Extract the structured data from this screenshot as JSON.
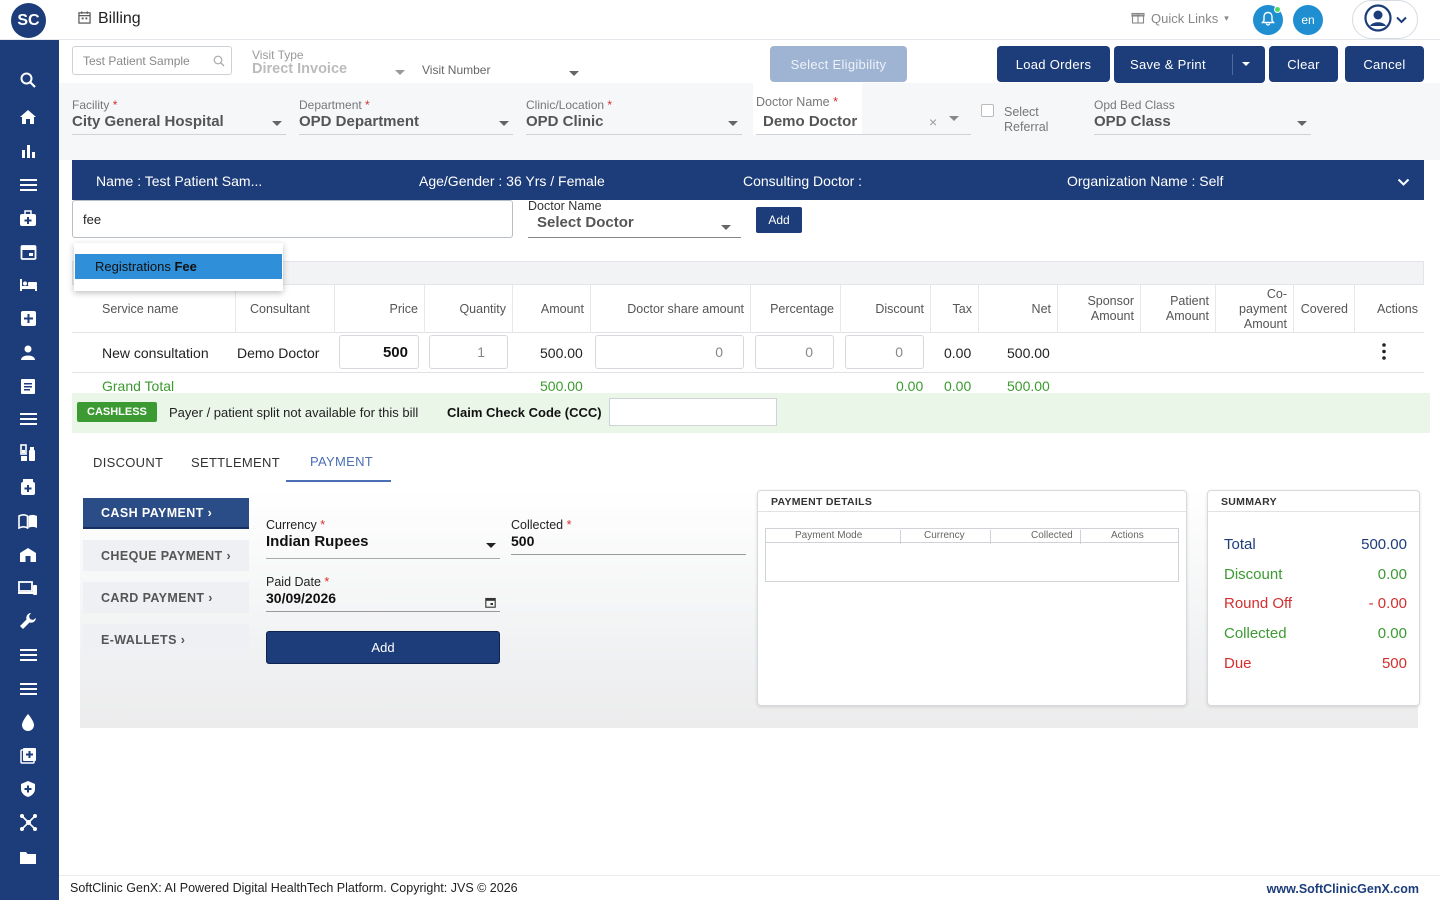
{
  "app": {
    "logo_text": "SC",
    "page_title": "Billing",
    "quick_links": "Quick Links",
    "language": "en"
  },
  "colors": {
    "brand": "#1d3d7a",
    "accent": "#1f8fd1",
    "success": "#3c9a33",
    "danger": "#d32f2f"
  },
  "sidebar": {
    "icons": [
      "search-icon",
      "home-icon",
      "bar-chart-icon",
      "menu-icon",
      "medical-bag-icon",
      "calendar-icon",
      "bed-icon",
      "plus-box-icon",
      "person-icon",
      "document-icon",
      "list-icon",
      "lab-icon",
      "pharmacy-icon",
      "book-icon",
      "hospital-icon",
      "devices-icon",
      "wrench-icon",
      "menu-icon",
      "list-icon",
      "blood-drop-icon",
      "add-box-icon",
      "shield-icon",
      "network-icon",
      "folder-icon"
    ]
  },
  "header_form": {
    "patient_search_placeholder": "Test Patient Sample",
    "visit_type_label": "Visit Type",
    "visit_type_value": "Direct Invoice",
    "visit_number_label": "Visit Number",
    "select_eligibility": "Select Eligibility",
    "load_orders": "Load Orders",
    "save_print": "Save & Print",
    "clear": "Clear",
    "cancel": "Cancel",
    "facility_label": "Facility",
    "facility_value": "City General Hospital",
    "department_label": "Department",
    "department_value": "OPD Department",
    "clinic_label": "Clinic/Location",
    "clinic_value": "OPD Clinic",
    "doctor_label": "Doctor Name",
    "doctor_value": "Demo Doctor",
    "select_referral_line1": "Select",
    "select_referral_line2": "Referral",
    "bed_class_label": "Opd Bed Class",
    "bed_class_value": "OPD Class",
    "required_mark": "*"
  },
  "banner": {
    "name": "Name :  Test Patient Sam...",
    "age_gender": "Age/Gender :  36 Yrs / Female",
    "consulting_doctor": "Consulting Doctor :",
    "organization": "Organization Name :  Self"
  },
  "service_entry": {
    "search_value": "fee",
    "suggestion_prefix": "Registrations ",
    "suggestion_match": "Fee",
    "doctor_label": "Doctor Name",
    "doctor_placeholder": "Select Doctor",
    "add_label": "Add"
  },
  "table": {
    "headers": {
      "service": "Service name",
      "consultant": "Consultant",
      "price": "Price",
      "quantity": "Quantity",
      "amount": "Amount",
      "doctor_share": "Doctor share amount",
      "percentage": "Percentage",
      "discount": "Discount",
      "tax": "Tax",
      "net": "Net",
      "sponsor_l1": "Sponsor",
      "sponsor_l2": "Amount",
      "patient_l1": "Patient",
      "patient_l2": "Amount",
      "copay_l1": "Co-",
      "copay_l2": "payment",
      "copay_l3": "Amount",
      "covered": "Covered",
      "actions": "Actions"
    },
    "rows": [
      {
        "service": "New consultation",
        "consultant": "Demo Doctor",
        "price": "500",
        "quantity": "1",
        "amount": "500.00",
        "doctor_share": "0",
        "percentage": "0",
        "discount": "0",
        "tax": "0.00",
        "net": "500.00"
      }
    ],
    "grand_total": {
      "label": "Grand Total",
      "amount": "500.00",
      "discount": "0.00",
      "tax": "0.00",
      "net": "500.00"
    }
  },
  "cashless": {
    "badge": "CASHLESS",
    "note": "Payer / patient split not available for this bill",
    "ccc_label": "Claim Check Code (CCC)"
  },
  "tabs": [
    "DISCOUNT",
    "SETTLEMENT",
    "PAYMENT"
  ],
  "payment": {
    "modes": [
      "CASH PAYMENT ›",
      "CHEQUE PAYMENT ›",
      "CARD PAYMENT ›",
      "E-WALLETS ›"
    ],
    "currency_label": "Currency",
    "currency_value": "Indian Rupees",
    "collected_label": "Collected",
    "collected_value": "500",
    "paid_date_label": "Paid Date",
    "paid_date_value": "30/09/2026",
    "add_label": "Add",
    "details_title": "PAYMENT DETAILS",
    "details_headers": [
      "Payment Mode",
      "Currency",
      "Collected",
      "Actions"
    ]
  },
  "summary": {
    "title": "SUMMARY",
    "rows": [
      {
        "label": "Total",
        "value": "500.00"
      },
      {
        "label": "Discount",
        "value": "0.00"
      },
      {
        "label": "Round Off",
        "value": "- 0.00"
      },
      {
        "label": "Collected",
        "value": "0.00"
      },
      {
        "label": "Due",
        "value": "500"
      }
    ]
  },
  "footer": {
    "left": "SoftClinic GenX: AI Powered Digital HealthTech Platform. Copyright: JVS © 2026",
    "right": "www.SoftClinicGenX.com"
  }
}
